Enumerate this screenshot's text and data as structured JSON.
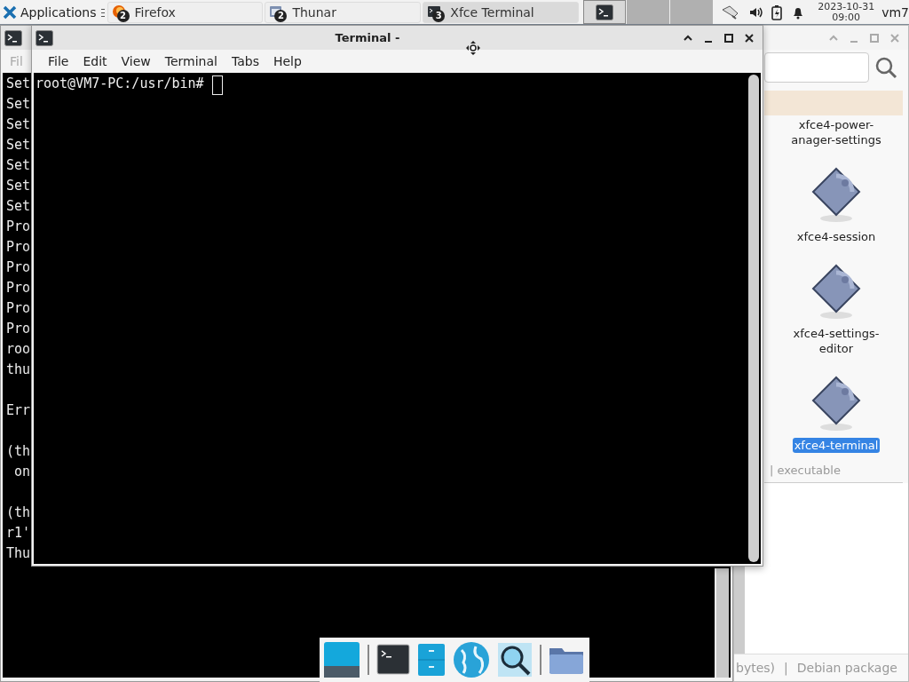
{
  "panel": {
    "menu_label": "Applications",
    "tasks": [
      {
        "kind": "firefox",
        "count": "2",
        "label": "Firefox",
        "selected": false
      },
      {
        "kind": "thunar",
        "count": "2",
        "label": "Thunar",
        "selected": false
      },
      {
        "kind": "terminal",
        "count": "3",
        "label": "Xfce Terminal",
        "selected": true
      }
    ],
    "clock": {
      "date": "2023-10-31",
      "time": "09:00"
    },
    "user": "vm7"
  },
  "back_terminal": {
    "menu": [
      "Fil"
    ],
    "blocks": [
      [
        "Set",
        "Set",
        "Set",
        "Set",
        "Set",
        "Set",
        "Set",
        "Pro",
        "Pro",
        "Pro",
        "Pro",
        "Pro",
        "Pro",
        "roo",
        "thu"
      ],
      [
        "Err"
      ],
      [
        "(th",
        " on"
      ],
      [
        "(th",
        "r1'",
        "Thu"
      ]
    ]
  },
  "terminal": {
    "title": "Terminal -",
    "menu": [
      "File",
      "Edit",
      "View",
      "Terminal",
      "Tabs",
      "Help"
    ],
    "prompt": "root@VM7-PC:/usr/bin#"
  },
  "file_manager": {
    "items": [
      {
        "kind": "label_only",
        "label": [
          "xfce4-power-",
          "anager-settings"
        ],
        "selected": false
      },
      {
        "kind": "executable",
        "label": [
          "xfce4-session"
        ],
        "selected": false
      },
      {
        "kind": "executable",
        "label": [
          "xfce4-settings-",
          "editor"
        ],
        "selected": false
      },
      {
        "kind": "executable",
        "label": [
          "xfce4-terminal"
        ],
        "selected": true
      }
    ],
    "item_status": "| executable",
    "status_bar": [
      "bytes)",
      "|",
      "Debian package"
    ]
  }
}
